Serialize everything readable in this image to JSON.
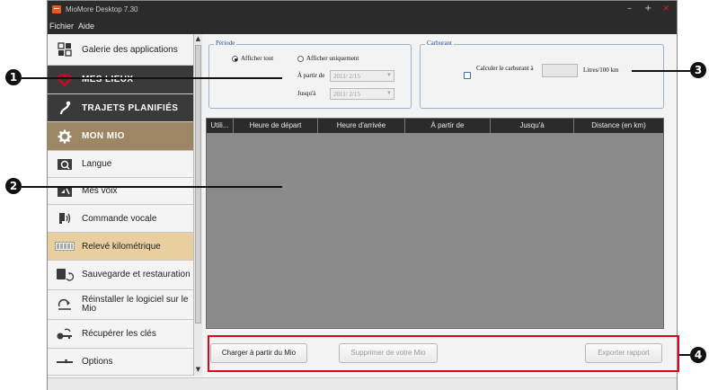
{
  "window": {
    "title": "MioMore Desktop 7.30",
    "controls": {
      "minimize": "–",
      "maximize": "+",
      "close": "×"
    }
  },
  "menu": [
    "Fichier",
    "Aide"
  ],
  "sidebar": {
    "items": [
      {
        "label": "Galerie des applications",
        "style": "sub",
        "icon": "grid-icon"
      },
      {
        "label": "MES LIEUX",
        "style": "dark",
        "icon": "heart-icon"
      },
      {
        "label": "TRAJETS PLANIFIÉS",
        "style": "dark",
        "icon": "route-icon"
      },
      {
        "label": "MON MIO",
        "style": "brown",
        "icon": "gear-icon"
      },
      {
        "label": "Langue",
        "style": "sub",
        "icon": "language-icon"
      },
      {
        "label": "Mes voix",
        "style": "sub",
        "icon": "voice-icon"
      },
      {
        "label": "Commande vocale",
        "style": "sub",
        "icon": "voice-command-icon"
      },
      {
        "label": "Relevé kilométrique",
        "style": "selected",
        "icon": "odometer-icon"
      },
      {
        "label": "Sauvegarde et restauration",
        "style": "sub",
        "icon": "backup-icon"
      },
      {
        "label": "Réinstaller le logiciel sur le Mio",
        "style": "sub",
        "icon": "reinstall-icon"
      },
      {
        "label": "Récupérer les clés",
        "style": "sub",
        "icon": "key-icon"
      },
      {
        "label": "Options",
        "style": "sub",
        "icon": "options-icon"
      }
    ]
  },
  "period": {
    "legend": "Période",
    "show_all": "Afficher tout",
    "show_only": "Afficher uniquement",
    "from_label": "À partir de",
    "to_label": "Jusqu'à",
    "from_value": "2011/ 2/15",
    "to_value": "2011/ 2/15",
    "selected": "show_all"
  },
  "fuel": {
    "legend": "Carburant",
    "calc_label": "Calculer le carburant à",
    "unit": "Litres/100 km",
    "checked": false
  },
  "table": {
    "columns": [
      "Utili...",
      "Heure de départ",
      "Heure d'arrivée",
      "À partir de",
      "Jusqu'à",
      "Distance (en km)"
    ],
    "rows": []
  },
  "buttons": {
    "load": "Charger à partir du Mio",
    "delete": "Supprimer de votre Mio",
    "export": "Exporter rapport"
  },
  "callouts": [
    "1",
    "2",
    "3",
    "4"
  ],
  "colors": {
    "callout_frame": "#e3001b",
    "sidebar_dark": "#3a3a3a",
    "sidebar_brown": "#9c8663",
    "selected_item": "#e9cf9f",
    "table_body": "#8a8a8a"
  }
}
